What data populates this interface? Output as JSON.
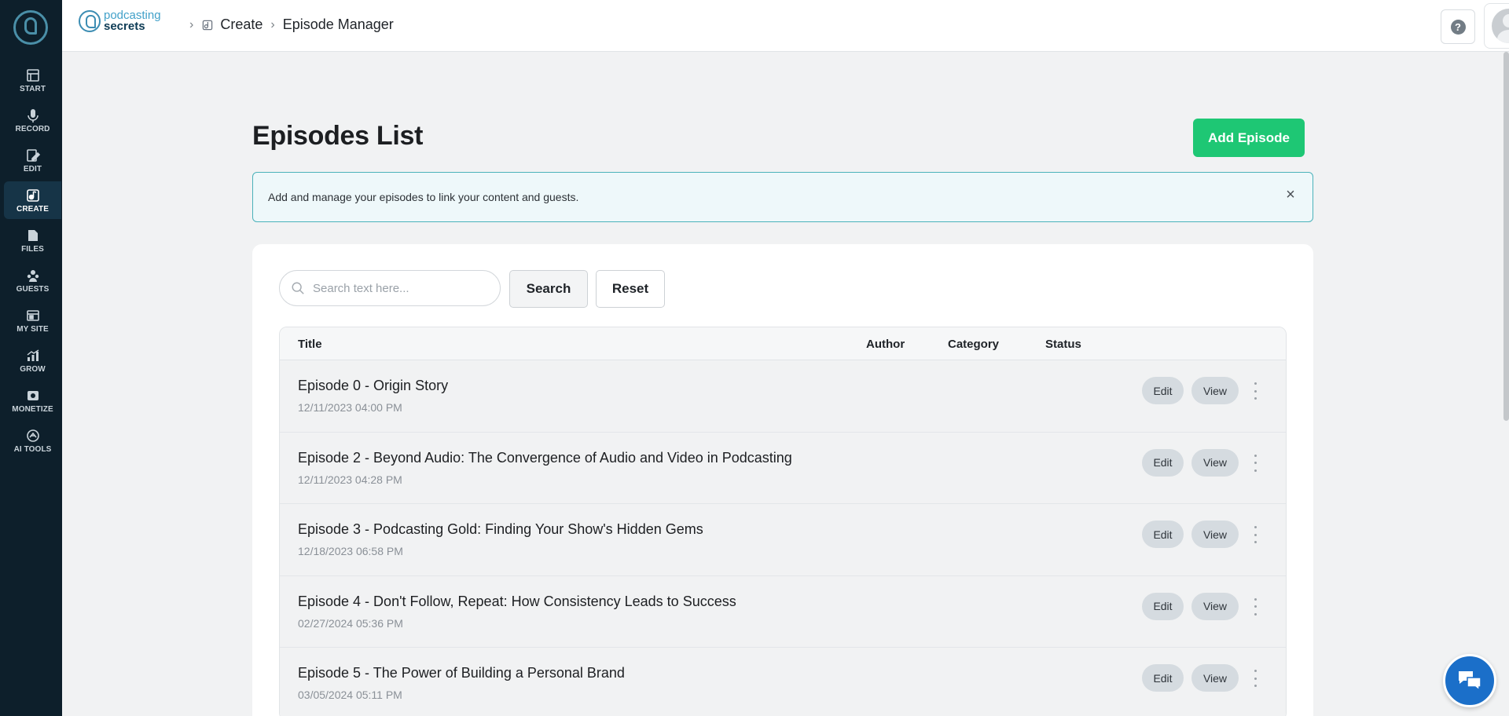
{
  "sidebar": {
    "items": [
      {
        "label": "START",
        "icon": "start-icon"
      },
      {
        "label": "RECORD",
        "icon": "microphone-icon"
      },
      {
        "label": "EDIT",
        "icon": "edit-icon"
      },
      {
        "label": "CREATE",
        "icon": "create-icon",
        "active": true
      },
      {
        "label": "FILES",
        "icon": "files-icon"
      },
      {
        "label": "GUESTS",
        "icon": "guests-icon"
      },
      {
        "label": "MY SITE",
        "icon": "my-site-icon"
      },
      {
        "label": "GROW",
        "icon": "grow-icon"
      },
      {
        "label": "MONETIZE",
        "icon": "monetize-icon"
      },
      {
        "label": "AI TOOLS",
        "icon": "ai-tools-icon"
      }
    ]
  },
  "header": {
    "brand_line1": "podcasting",
    "brand_line2": "secrets",
    "breadcrumb": [
      "Create",
      "Episode Manager"
    ]
  },
  "main": {
    "title": "Episodes List",
    "add_button": "Add Episode",
    "info": "Add and manage your episodes to link your content and guests.",
    "search": {
      "placeholder": "Search text here...",
      "value": ""
    },
    "search_button": "Search",
    "reset_button": "Reset",
    "table": {
      "columns": [
        "Title",
        "Author",
        "Category",
        "Status"
      ],
      "rows": [
        {
          "title": "Episode 0 - Origin Story",
          "date": "12/11/2023 04:00 PM"
        },
        {
          "title": "Episode 2 - Beyond Audio: The Convergence of Audio and Video in Podcasting",
          "date": "12/11/2023 04:28 PM"
        },
        {
          "title": "Episode 3 - Podcasting Gold: Finding Your Show's Hidden Gems",
          "date": "12/18/2023 06:58 PM"
        },
        {
          "title": "Episode 4 - Don't Follow, Repeat: How Consistency Leads to Success",
          "date": "02/27/2024 05:36 PM"
        },
        {
          "title": "Episode 5 - The Power of Building a Personal Brand",
          "date": "03/05/2024 05:11 PM"
        }
      ],
      "edit_label": "Edit",
      "view_label": "View"
    }
  },
  "colors": {
    "sidebar_bg": "#0d1f2b",
    "accent_green": "#1ec774",
    "banner_border": "#4bb2ba",
    "chat_blue": "#1b6fc9"
  }
}
